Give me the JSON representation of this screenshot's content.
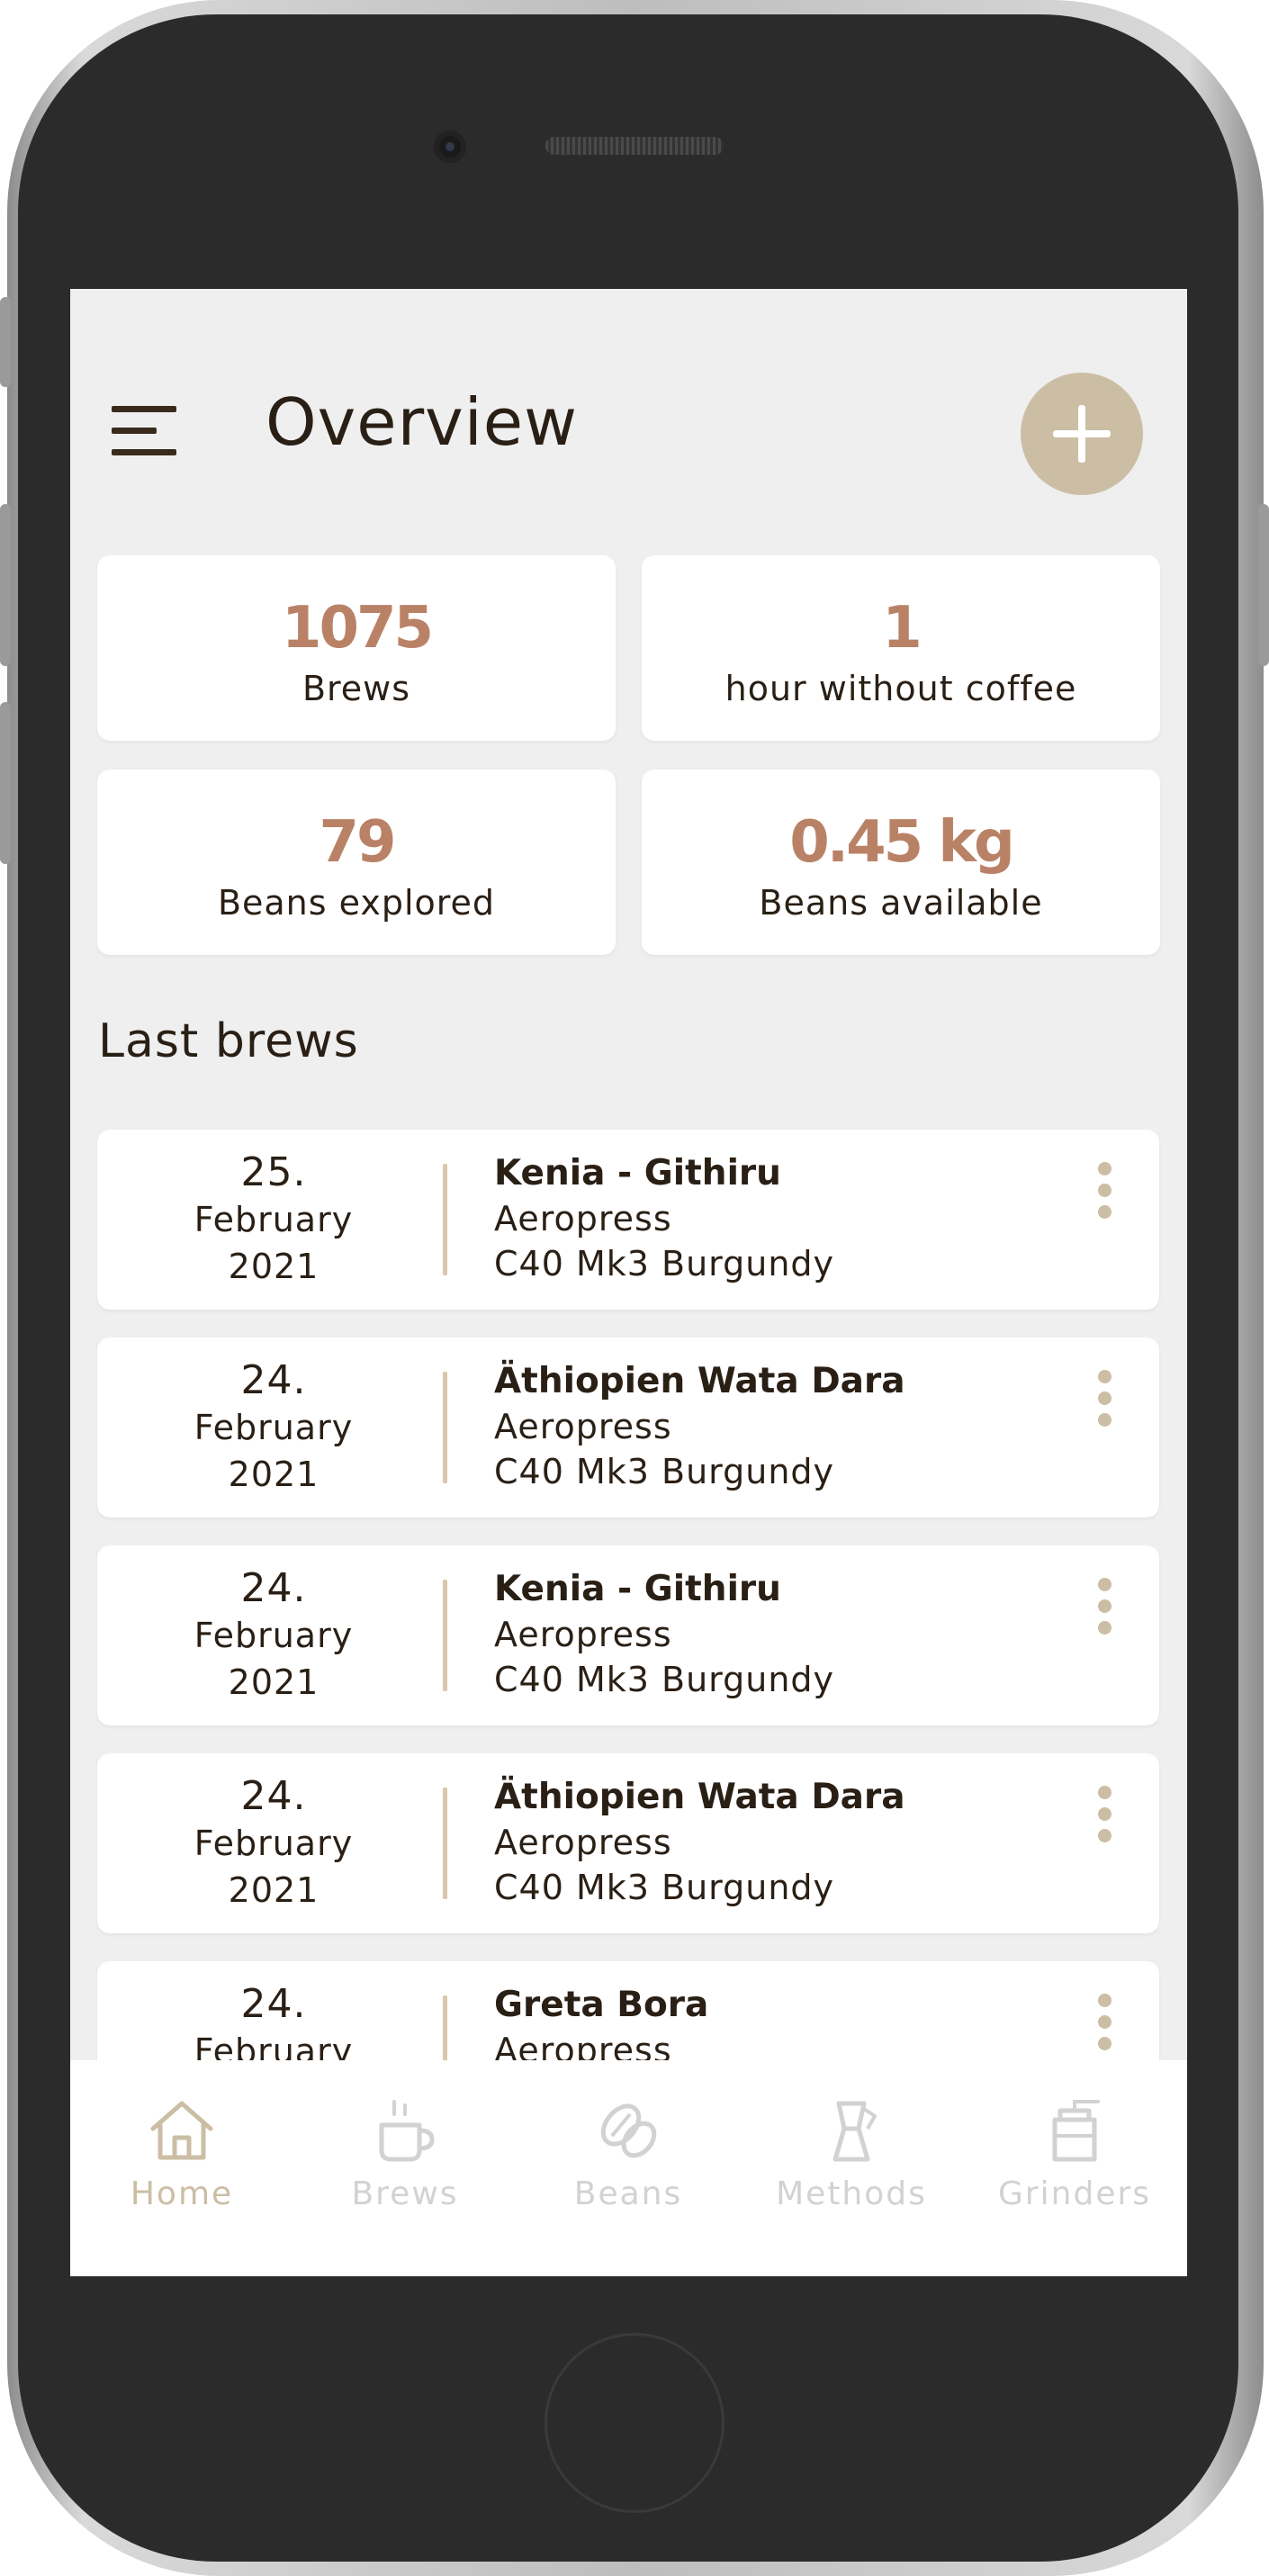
{
  "header": {
    "title": "Overview"
  },
  "stats": [
    {
      "value": "1075",
      "label": "Brews"
    },
    {
      "value": "1",
      "label": "hour without coffee"
    },
    {
      "value": "79",
      "label": "Beans explored"
    },
    {
      "value": "0.45 kg",
      "label": "Beans available"
    }
  ],
  "last_brews": {
    "title": "Last brews",
    "items": [
      {
        "day": "25.",
        "month": "February",
        "year": "2021",
        "bean": "Kenia - Githiru",
        "method": "Aeropress",
        "grinder": "C40 Mk3 Burgundy"
      },
      {
        "day": "24.",
        "month": "February",
        "year": "2021",
        "bean": "Äthiopien Wata Dara",
        "method": "Aeropress",
        "grinder": "C40 Mk3 Burgundy"
      },
      {
        "day": "24.",
        "month": "February",
        "year": "2021",
        "bean": "Kenia - Githiru",
        "method": "Aeropress",
        "grinder": "C40 Mk3 Burgundy"
      },
      {
        "day": "24.",
        "month": "February",
        "year": "2021",
        "bean": "Äthiopien Wata Dara",
        "method": "Aeropress",
        "grinder": "C40 Mk3 Burgundy"
      },
      {
        "day": "24.",
        "month": "February",
        "year": "",
        "bean": "Greta Bora",
        "method": "Aeropress",
        "grinder": ""
      }
    ]
  },
  "tabbar": {
    "items": [
      {
        "label": "Home",
        "icon": "home-icon",
        "active": true
      },
      {
        "label": "Brews",
        "icon": "cup-icon",
        "active": false
      },
      {
        "label": "Beans",
        "icon": "bean-icon",
        "active": false
      },
      {
        "label": "Methods",
        "icon": "moka-pot-icon",
        "active": false
      },
      {
        "label": "Grinders",
        "icon": "grinder-icon",
        "active": false
      }
    ]
  },
  "colors": {
    "accent": "#cbbea4",
    "stat_value": "#b98266",
    "text": "#2a1f15",
    "background": "#efefef",
    "inactive_tab": "#d2d2d2"
  }
}
